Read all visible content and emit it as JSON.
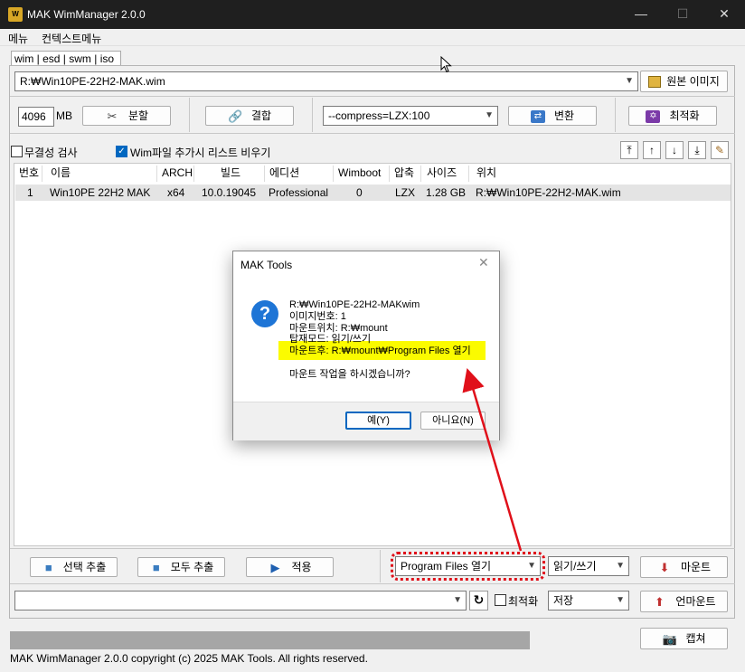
{
  "window": {
    "title": "MAK WimManager 2.0.0",
    "minimize": "—",
    "maximize": "☐",
    "close": "✕"
  },
  "menu": {
    "items": [
      "메뉴",
      "컨텍스트메뉴"
    ]
  },
  "tabs": {
    "label": "wim | esd | swm | iso"
  },
  "source": {
    "path": "R:₩Win10PE-22H2-MAK.wim",
    "original_image_button": "원본 이미지"
  },
  "toolbar1": {
    "split_size": "4096",
    "unit": "MB",
    "split_button": "분할",
    "merge_button": "결합",
    "compress_option": "--compress=LZX:100",
    "convert_button": "변환",
    "optimize_button": "최적화"
  },
  "options": {
    "integrity_check": "무결성 검사",
    "clear_list": "Wim파일 추가시 리스트 비우기",
    "integrity_checked": false,
    "clear_list_checked": true
  },
  "list": {
    "columns": [
      "번호",
      "이름",
      "ARCH",
      "빌드",
      "에디션",
      "Wimboot",
      "압축",
      "사이즈",
      "위치"
    ],
    "rows": [
      [
        "1",
        "Win10PE 22H2 MAK",
        "x64",
        "10.0.19045",
        "Professional",
        "0",
        "LZX",
        "1.28 GB",
        "R:₩Win10PE-22H2-MAK.wim"
      ]
    ]
  },
  "bottom1": {
    "extract_selected": "선택 추출",
    "extract_all": "모두 추출",
    "apply": "적용",
    "after_mount": "Program Files 열기",
    "mount_mode": "읽기/쓰기",
    "mount_button": "마운트"
  },
  "bottom2": {
    "path": "",
    "optimize_label": "최적화",
    "save_option": "저장",
    "unmount_button": "언마운트"
  },
  "capture_button": "캡쳐",
  "copyright": "MAK WimManager 2.0.0 copyright (c) 2025 MAK Tools. All rights reserved.",
  "dialog": {
    "title": "MAK Tools",
    "close": "✕",
    "lines": [
      "R:₩Win10PE-22H2-MAKwim",
      "이미지번호: 1",
      "마운트위치: R:₩mount",
      "탑재모드: 읽기/쓰기",
      "마운트후: R:₩mount₩Program Files 열기"
    ],
    "question": "마운트 작업을 하시겠습니까?",
    "yes_button": "예(Y)",
    "no_button": "아니요(N)"
  },
  "colors": {
    "highlight": "#fbfb00",
    "annotation": "#e0101a",
    "accent": "#0067c0"
  }
}
